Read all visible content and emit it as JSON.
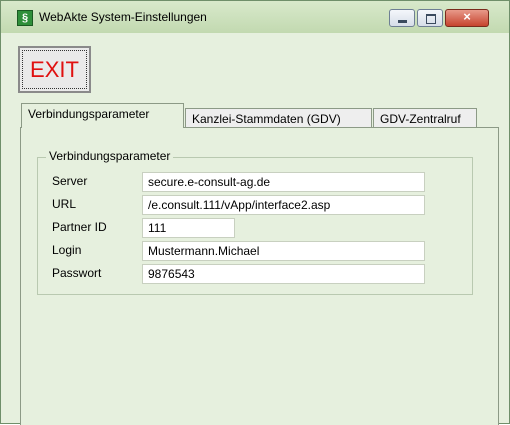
{
  "window": {
    "title": "WebAkte System-Einstellungen",
    "icon_glyph": "§",
    "close_glyph": "×"
  },
  "toolbar": {
    "exit_label": "EXIT"
  },
  "tabs": [
    {
      "label": "Verbindungsparameter",
      "active": true
    },
    {
      "label": "Kanzlei-Stammdaten (GDV)",
      "active": false
    },
    {
      "label": "GDV-Zentralruf",
      "active": false
    }
  ],
  "connection": {
    "group_title": "Verbindungsparameter",
    "fields": [
      {
        "label": "Server",
        "value": "secure.e-consult-ag.de"
      },
      {
        "label": "URL",
        "value": "/e.consult.111/vApp/interface2.asp"
      },
      {
        "label": "Partner ID",
        "value": "111"
      },
      {
        "label": "Login",
        "value": "Mustermann.Michael"
      },
      {
        "label": "Passwort",
        "value": "9876543"
      }
    ]
  },
  "colors": {
    "titlebar": "#c8ddb8",
    "panel_background": "#e6f0de",
    "exit_text": "#e01010",
    "close_button": "#c6432e"
  }
}
